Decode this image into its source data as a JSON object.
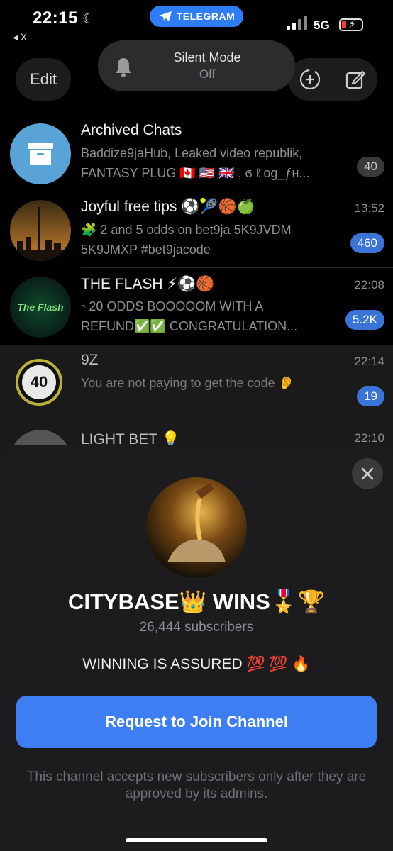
{
  "status": {
    "time": "22:15",
    "back_label": "◂ X",
    "app_pill": "TELEGRAM",
    "network": "5G"
  },
  "header": {
    "edit_label": "Edit",
    "silent_title": "Silent Mode",
    "silent_state": "Off"
  },
  "chats": [
    {
      "name": "Archived Chats",
      "preview": "Baddize9jaHub, Leaked video republik, FANTASY PLUG 🇨🇦 🇺🇸 🇬🇧 , ϭ ℓ og_ƒн...",
      "time": "",
      "badge": "40"
    },
    {
      "name": "Joyful free tips ⚽🎾🏀🍏",
      "preview": "🧩 2 and 5 odds on bet9ja 5K9JVDM 5K9JMXP #bet9jacode",
      "time": "13:52",
      "badge": "460"
    },
    {
      "name": "THE FLASH ⚡⚽🏀",
      "preview": "▫ 20 ODDS BOOOOOM WITH A REFUND✅✅ CONGRATULATION...",
      "time": "22:08",
      "badge": "5.2K",
      "logo_text": "The Flash"
    },
    {
      "name": "9Z",
      "preview": "You are not paying to get the code 👂",
      "time": "22:14",
      "badge": "19",
      "logo_text": "40"
    },
    {
      "name": "LIGHT BET 💡",
      "preview": "",
      "time": "22:10"
    }
  ],
  "channel": {
    "title": "CITYBASE👑 WINS🎖️🏆",
    "subscribers": "26,444 subscribers",
    "description": "WINNING IS ASSURED 💯 💯 🔥",
    "join_label": "Request to Join Channel",
    "note": "This channel accepts new subscribers only after they are approved by its admins."
  },
  "colors": {
    "accent": "#3d7ff2",
    "badge_blue": "#3a74d6",
    "sheet_bg": "#1c1c1e"
  }
}
